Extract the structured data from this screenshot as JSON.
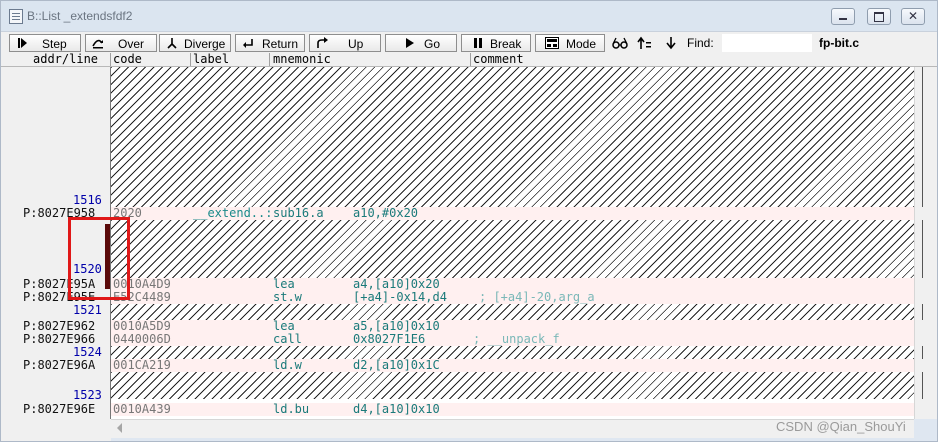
{
  "window": {
    "title": "B::List _extendsfdf2",
    "controls": [
      "minimize-icon",
      "restore-icon",
      "close-icon"
    ]
  },
  "toolbar": {
    "buttons": [
      {
        "label": "Step",
        "icon": "step-icon"
      },
      {
        "label": "Over",
        "icon": "step-over-icon"
      },
      {
        "label": "Diverge",
        "icon": "diverge-icon"
      },
      {
        "label": "Return",
        "icon": "return-icon"
      },
      {
        "label": "Up",
        "icon": "up-icon"
      },
      {
        "label": "Go",
        "icon": "go-icon"
      },
      {
        "label": "Break",
        "icon": "break-icon"
      },
      {
        "label": "Mode",
        "icon": "mode-icon"
      }
    ],
    "find_label": "Find:",
    "find_value": "",
    "file_name": "fp-bit.c"
  },
  "columns": [
    "addr/line",
    "code",
    "label",
    "mnemonic",
    "comment"
  ],
  "rows": [
    {
      "line": "1516"
    },
    {
      "addr": "P:8027E958",
      "code": "2020",
      "label": "__extend..:",
      "mnemonic": "sub16.a",
      "operands": "a10,#0x20",
      "comment": ""
    },
    {
      "line": "1520"
    },
    {
      "addr": "P:8027E95A",
      "code": "0010A4D9",
      "label": "",
      "mnemonic": "lea",
      "operands": "a4,[a10]0x20",
      "comment": ""
    },
    {
      "addr": "P:8027E95E",
      "code": "E52C4489",
      "label": "",
      "mnemonic": "st.w",
      "operands": "[+a4]-0x14,d4",
      "comment": "; [+a4]-20,arg_a"
    },
    {
      "line": "1521"
    },
    {
      "addr": "P:8027E962",
      "code": "0010A5D9",
      "label": "",
      "mnemonic": "lea",
      "operands": "a5,[a10]0x10",
      "comment": ""
    },
    {
      "addr": "P:8027E966",
      "code": "0440006D",
      "label": "",
      "mnemonic": "call",
      "operands": "0x8027F1E6",
      "comment": "; __unpack_f"
    },
    {
      "line": "1524"
    },
    {
      "addr": "P:8027E96A",
      "code": "001CA219",
      "label": "",
      "mnemonic": "ld.w",
      "operands": "d2,[a10]0x1C",
      "comment": ""
    },
    {
      "line": "1523"
    },
    {
      "addr": "P:8027E96E",
      "code": "0010A439",
      "label": "",
      "mnemonic": "ld.bu",
      "operands": "d4,[a10]0x10",
      "comment": ""
    }
  ],
  "watermark": "CSDN @Qian_ShouYi"
}
